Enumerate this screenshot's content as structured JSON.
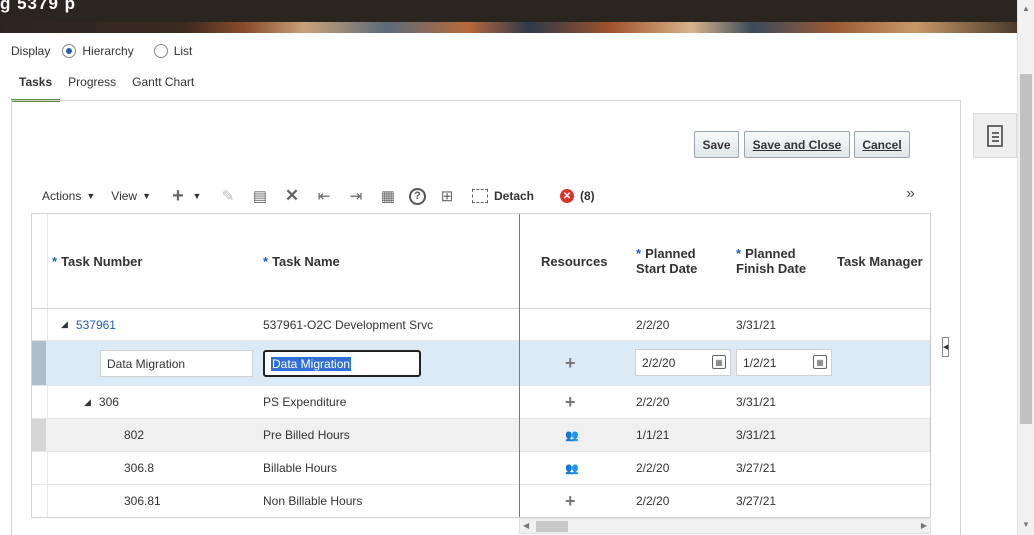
{
  "banner": {
    "title_fragment": "g                    5379            p"
  },
  "display": {
    "label": "Display",
    "options": [
      "Hierarchy",
      "List"
    ],
    "selected": "Hierarchy"
  },
  "tabs": [
    {
      "label": "Tasks"
    },
    {
      "label": "Progress"
    },
    {
      "label": "Gantt Chart"
    }
  ],
  "active_tab": "Tasks",
  "buttons": {
    "save": "Save",
    "save_and_close": "Save and Close",
    "cancel": "Cancel"
  },
  "toolbar": {
    "actions_label": "Actions",
    "view_label": "View",
    "detach_label": "Detach",
    "error_count": "(8)",
    "icons": [
      "add-icon",
      "add-dropdown-icon",
      "edit-icon",
      "copy-icon",
      "delete-icon",
      "outdent-icon",
      "indent-icon",
      "columns-icon",
      "help-icon",
      "export-icon",
      "detach-icon",
      "error-icon",
      "more-icon"
    ]
  },
  "table": {
    "headers": {
      "task_number": "Task Number",
      "task_name": "Task Name",
      "resources": "Resources",
      "planned_start_line1": "Planned",
      "planned_start_line2": "Start Date",
      "planned_finish_line1": "Planned",
      "planned_finish_line2": "Finish Date",
      "task_manager": "Task Manager"
    },
    "rows": [
      {
        "number": "537961",
        "name": "537961-O2C Development Srvc",
        "resources": "",
        "start": "2/2/20",
        "finish": "3/31/21"
      },
      {
        "number": "Data Migration",
        "name": "Data Migration",
        "resources": "add",
        "start": "2/2/20",
        "finish": "1/2/21"
      },
      {
        "number": "306",
        "name": "PS Expenditure",
        "resources": "add",
        "start": "2/2/20",
        "finish": "3/31/21"
      },
      {
        "number": "802",
        "name": "Pre Billed Hours",
        "resources": "people",
        "start": "1/1/21",
        "finish": "3/31/21"
      },
      {
        "number": "306.8",
        "name": "Billable Hours",
        "resources": "people",
        "start": "2/2/20",
        "finish": "3/27/21"
      },
      {
        "number": "306.81",
        "name": "Non Billable Hours",
        "resources": "add",
        "start": "2/2/20",
        "finish": "3/27/21"
      }
    ]
  },
  "colors": {
    "link": "#1f5fb0",
    "selected_row": "#dbeaf7",
    "tab_underline": "#5a8a3a",
    "error": "#d9362b",
    "freeze_line": "#2e8fd3"
  }
}
